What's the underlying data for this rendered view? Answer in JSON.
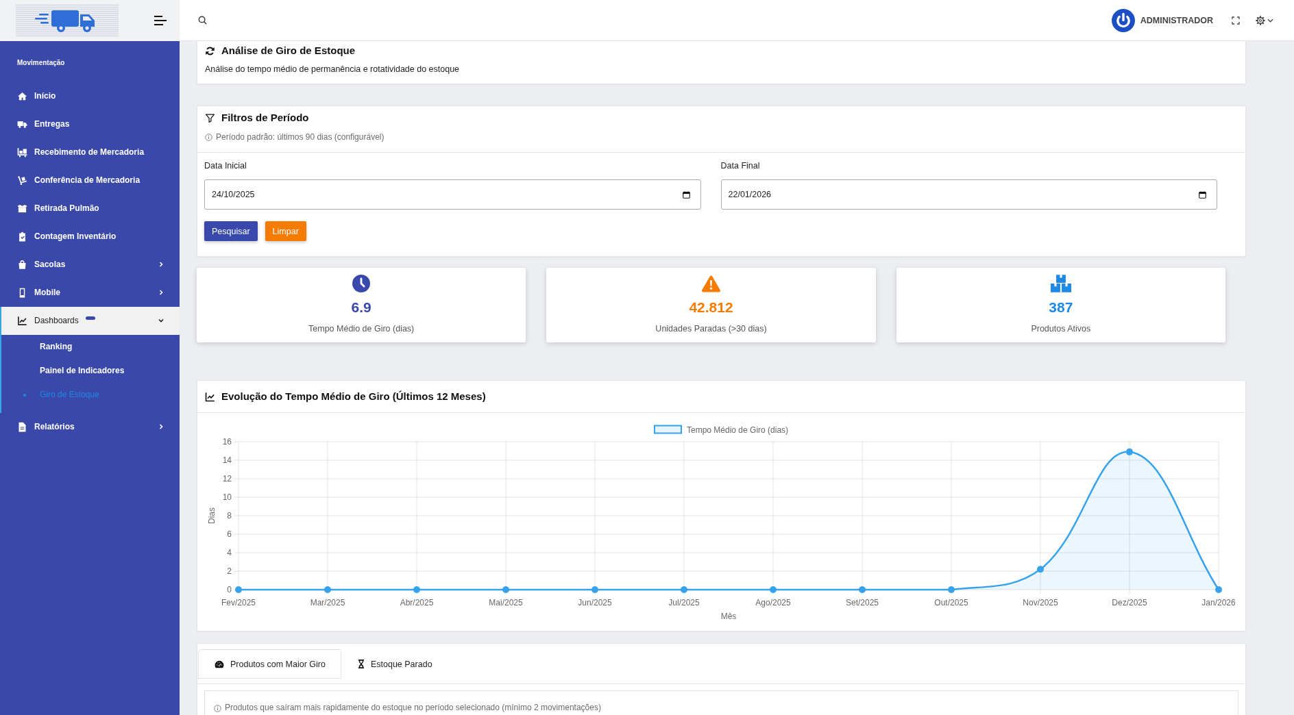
{
  "sidebar": {
    "section_title": "Movimentação",
    "items": [
      {
        "label": "Início",
        "kind": "link",
        "badge": false
      },
      {
        "label": "Entregas",
        "kind": "link",
        "badge": false
      },
      {
        "label": "Recebimento de Mercadoria",
        "kind": "link",
        "badge": false
      },
      {
        "label": "Conferência de Mercadoria",
        "kind": "link",
        "badge": false
      },
      {
        "label": "Retirada Pulmão",
        "kind": "link",
        "badge": false
      },
      {
        "label": "Contagem Inventário",
        "kind": "link",
        "badge": false
      },
      {
        "label": "Sacolas",
        "kind": "group",
        "expanded": false,
        "badge": false
      },
      {
        "label": "Mobile",
        "kind": "group",
        "expanded": false,
        "badge": false
      },
      {
        "label": "Dashboards",
        "kind": "group",
        "expanded": true,
        "badge": true,
        "children": [
          {
            "label": "Ranking",
            "selected": false
          },
          {
            "label": "Painel de Indicadores",
            "selected": false
          },
          {
            "label": "Giro de Estoque",
            "selected": true
          }
        ]
      },
      {
        "label": "Relatórios",
        "kind": "group",
        "expanded": false,
        "badge": false
      }
    ]
  },
  "topbar": {
    "user_name": "ADMINISTRADOR"
  },
  "page_header": {
    "title": "Análise de Giro de Estoque",
    "subtitle": "Análise do tempo médio de permanência e rotatividade do estoque"
  },
  "filters": {
    "title": "Filtros de Período",
    "note": "Período padrão: últimos 90 dias (configurável)",
    "fields": [
      {
        "label": "Data Inicial",
        "value": "24/10/2025"
      },
      {
        "label": "Data Final",
        "value": "22/01/2026"
      }
    ],
    "buttons": [
      {
        "label": "Pesquisar",
        "kind": "primary"
      },
      {
        "label": "Limpar",
        "kind": "warning"
      }
    ]
  },
  "stats": [
    {
      "kind": "duration",
      "value": "6.9",
      "label": "Tempo Médio de Giro (dias)",
      "color": "#3949ab"
    },
    {
      "kind": "alert",
      "value": "42.812",
      "label": "Unidades Paradas (>30 dias)",
      "color": "#f57c00"
    },
    {
      "kind": "products",
      "value": "387",
      "label": "Produtos Ativos",
      "color": "#1e88e5"
    }
  ],
  "chart_card": {
    "title": "Evolução do Tempo Médio de Giro (Últimos 12 Meses)",
    "chart_data": {
      "type": "area",
      "xlabel": "Mês",
      "ylabel": "Dias",
      "categories": [
        "Fev/2025",
        "Mar/2025",
        "Abr/2025",
        "Mai/2025",
        "Jun/2025",
        "Jul/2025",
        "Ago/2025",
        "Set/2025",
        "Out/2025",
        "Nov/2025",
        "Dez/2025",
        "Jan/2026"
      ],
      "series": [
        {
          "name": "Tempo Médio de Giro (dias)",
          "color": "#36a2eb",
          "values": [
            0,
            0,
            0,
            0,
            0,
            0,
            0,
            0,
            0,
            2.2,
            14.9,
            0
          ]
        }
      ],
      "ylim": [
        0,
        16
      ],
      "yticks": [
        0,
        2,
        4,
        6,
        8,
        10,
        12,
        14,
        16
      ],
      "grid": true
    }
  },
  "tabs_card": {
    "tabs": [
      {
        "label": "Produtos com Maior Giro",
        "selected": true
      },
      {
        "label": "Estoque Parado",
        "selected": false
      }
    ],
    "note": "Produtos que saíram mais rapidamente do estoque no período selecionado (mínimo 2 movimentações)"
  }
}
